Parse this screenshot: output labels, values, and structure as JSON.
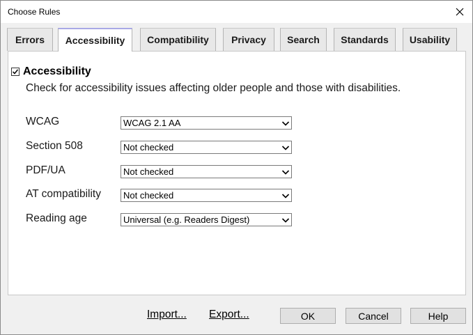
{
  "window": {
    "title": "Choose Rules"
  },
  "tabs": [
    {
      "label": "Errors",
      "active": false
    },
    {
      "label": "Accessibility",
      "active": true
    },
    {
      "label": "Compatibility",
      "active": false
    },
    {
      "label": "Privacy",
      "active": false
    },
    {
      "label": "Search",
      "active": false
    },
    {
      "label": "Standards",
      "active": false
    },
    {
      "label": "Usability",
      "active": false
    }
  ],
  "accessibility": {
    "checkbox_label": "Accessibility",
    "checked": true,
    "description": "Check for accessibility issues affecting older people and those with disabilities."
  },
  "settings": [
    {
      "label": "WCAG",
      "value": "WCAG 2.1 AA"
    },
    {
      "label": "Section 508",
      "value": "Not checked"
    },
    {
      "label": "PDF/UA",
      "value": "Not checked"
    },
    {
      "label": "AT compatibility",
      "value": "Not checked"
    },
    {
      "label": "Reading age",
      "value": "Universal (e.g. Readers Digest)"
    }
  ],
  "footer": {
    "import_label": "Import...",
    "export_label": "Export...",
    "ok_label": "OK",
    "cancel_label": "Cancel",
    "help_label": "Help"
  },
  "icons": {
    "close": "close-icon",
    "checkmark": "checkmark-icon",
    "dropdown": "chevron-down-icon"
  }
}
